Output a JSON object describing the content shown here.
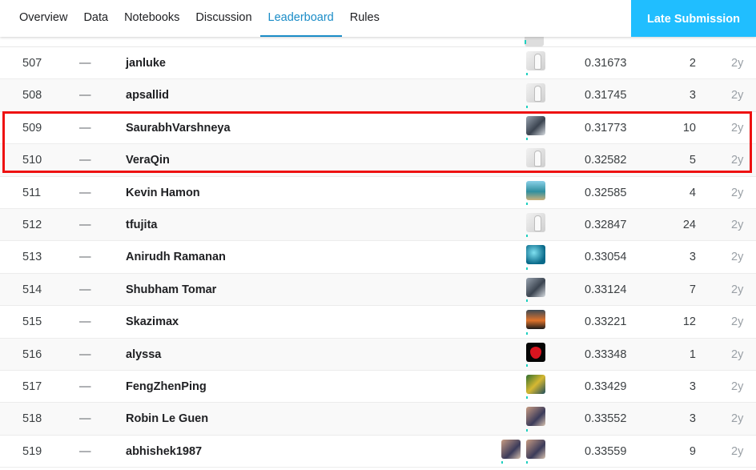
{
  "tabs": [
    {
      "label": "Overview"
    },
    {
      "label": "Data"
    },
    {
      "label": "Notebooks"
    },
    {
      "label": "Discussion"
    },
    {
      "label": "Leaderboard",
      "active": true
    },
    {
      "label": "Rules"
    }
  ],
  "late_submission_label": "Late Submission",
  "rows": [
    {
      "rank": "507",
      "change": "—",
      "team": "janluke",
      "avatar": "goose-avatar",
      "score": "0.31673",
      "entries": "2",
      "last": "2y"
    },
    {
      "rank": "508",
      "change": "—",
      "team": "apsallid",
      "avatar": "goose-avatar",
      "score": "0.31745",
      "entries": "3",
      "last": "2y"
    },
    {
      "rank": "509",
      "change": "—",
      "team": "SaurabhVarshneya",
      "avatar": "photo-avatar",
      "score": "0.31773",
      "entries": "10",
      "last": "2y"
    },
    {
      "rank": "510",
      "change": "—",
      "team": "VeraQin",
      "avatar": "goose-avatar",
      "score": "0.32582",
      "entries": "5",
      "last": "2y"
    },
    {
      "rank": "511",
      "change": "—",
      "team": "Kevin Hamon",
      "avatar": "beach-avatar",
      "score": "0.32585",
      "entries": "4",
      "last": "2y"
    },
    {
      "rank": "512",
      "change": "—",
      "team": "tfujita",
      "avatar": "goose-avatar",
      "score": "0.32847",
      "entries": "24",
      "last": "2y"
    },
    {
      "rank": "513",
      "change": "—",
      "team": "Anirudh Ramanan",
      "avatar": "water-avatar",
      "score": "0.33054",
      "entries": "3",
      "last": "2y"
    },
    {
      "rank": "514",
      "change": "—",
      "team": "Shubham Tomar",
      "avatar": "photo-avatar",
      "score": "0.33124",
      "entries": "7",
      "last": "2y"
    },
    {
      "rank": "515",
      "change": "—",
      "team": "Skazimax",
      "avatar": "sunset-avatar",
      "score": "0.33221",
      "entries": "12",
      "last": "2y"
    },
    {
      "rank": "516",
      "change": "—",
      "team": "alyssa",
      "avatar": "strawberry-avatar",
      "score": "0.33348",
      "entries": "1",
      "last": "2y"
    },
    {
      "rank": "517",
      "change": "—",
      "team": "FengZhenPing",
      "avatar": "leaf-avatar",
      "score": "0.33429",
      "entries": "3",
      "last": "2y"
    },
    {
      "rank": "518",
      "change": "—",
      "team": "Robin Le Guen",
      "avatar": "people-avatar",
      "score": "0.33552",
      "entries": "3",
      "last": "2y"
    },
    {
      "rank": "519",
      "change": "—",
      "team": "abhishek1987",
      "avatar": "people-avatar",
      "score": "0.33559",
      "entries": "9",
      "last": "2y"
    }
  ],
  "colors": {
    "accent": "#20beff",
    "active_tab": "#1a8cc7",
    "highlight_box": "#ee1111"
  }
}
